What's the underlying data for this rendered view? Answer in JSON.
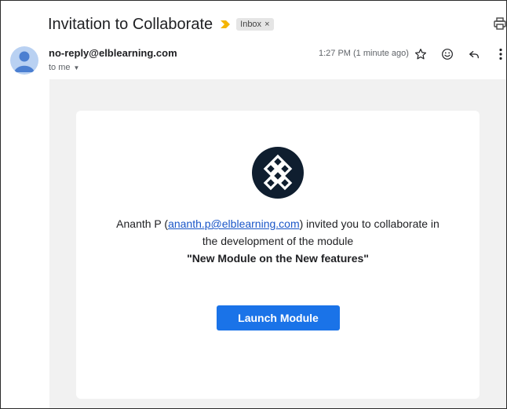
{
  "email": {
    "subject": "Invitation to Collaborate",
    "label_chip": "Inbox",
    "label_chip_close": "×",
    "sender": "no-reply@elblearning.com",
    "recipient": "to me",
    "time": "1:27 PM (1 minute ago)"
  },
  "body": {
    "inviter_name": "Ananth P (",
    "inviter_email": "ananth.p@elblearning.com",
    "invite_rest": ") invited you to collaborate in",
    "line2": "the development of the module",
    "module_name": "\"New Module on the New features\"",
    "button_label": "Launch Module"
  },
  "icons": [
    "important-marker-icon",
    "print-icon",
    "avatar",
    "star-icon",
    "emoji-icon",
    "reply-icon",
    "more-vert-icon",
    "caret-down-icon",
    "logo-icon"
  ],
  "colors": {
    "accent": "#1a73e8",
    "link": "#1a56c8",
    "important": "#f4b400",
    "logo_bg": "#0f1e2f",
    "body_bg": "#f1f1f1"
  }
}
